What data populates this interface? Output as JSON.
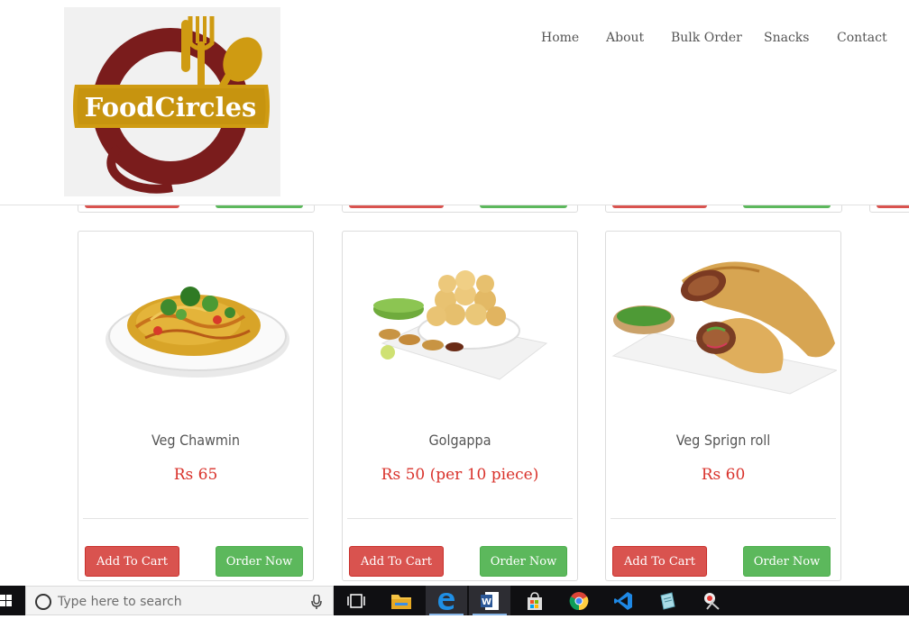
{
  "logo": {
    "text": "FoodCircles"
  },
  "nav": {
    "items": [
      "Home",
      "About",
      "Bulk Order",
      "Snacks",
      "Contact"
    ]
  },
  "products": [
    {
      "name": "Veg Chawmin",
      "price": "Rs 65",
      "cart_label": "Add To Cart",
      "order_label": "Order Now"
    },
    {
      "name": "Golgappa",
      "price": "Rs 50 (per 10 piece)",
      "cart_label": "Add To Cart",
      "order_label": "Order Now"
    },
    {
      "name": "Veg Sprign roll",
      "price": "Rs 60",
      "cart_label": "Add To Cart",
      "order_label": "Order Now"
    }
  ],
  "taskbar": {
    "search_placeholder": "Type here to search",
    "apps": [
      "task-view",
      "file-explorer",
      "edge",
      "word",
      "store",
      "chrome",
      "vscode",
      "notepad",
      "snipping-tool"
    ]
  },
  "colors": {
    "cart_button": "#d9534f",
    "order_button": "#5cb85c",
    "price_text": "#d9322b",
    "logo_maroon": "#7a1c1c",
    "logo_gold": "#cf9b12"
  }
}
